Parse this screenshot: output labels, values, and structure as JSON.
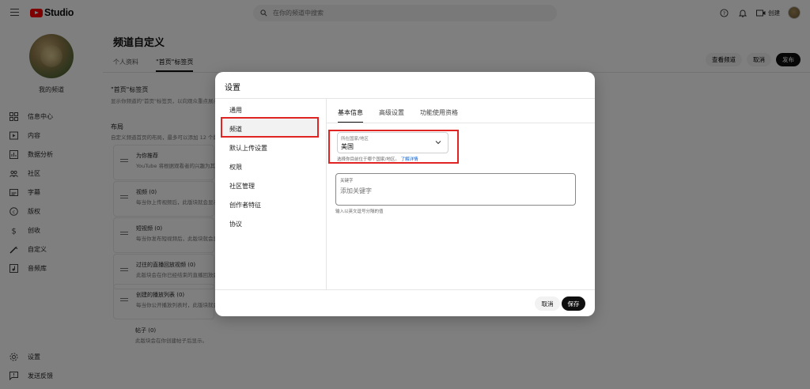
{
  "app": {
    "brand": "Studio",
    "brand_color": "#ff0000"
  },
  "search": {
    "placeholder": "在你的频道中搜索"
  },
  "topbar": {
    "create_label": "创建"
  },
  "sidebar": {
    "channel_name": "我的频道",
    "items": [
      {
        "label": "信息中心",
        "icon": "dashboard-icon"
      },
      {
        "label": "内容",
        "icon": "content-icon"
      },
      {
        "label": "数据分析",
        "icon": "analytics-icon"
      },
      {
        "label": "社区",
        "icon": "community-icon"
      },
      {
        "label": "字幕",
        "icon": "subtitles-icon"
      },
      {
        "label": "版权",
        "icon": "copyright-icon"
      },
      {
        "label": "创收",
        "icon": "dollar-icon"
      },
      {
        "label": "自定义",
        "icon": "customize-icon"
      },
      {
        "label": "音频库",
        "icon": "audio-library-icon"
      }
    ],
    "bottom": [
      {
        "label": "设置",
        "icon": "settings-icon"
      },
      {
        "label": "发送反馈",
        "icon": "feedback-icon"
      }
    ]
  },
  "page": {
    "title": "频道自定义",
    "tabs": [
      "个人资料",
      "\"首页\"标签页"
    ],
    "active_tab": 1,
    "buttons": {
      "view_channel": "查看频道",
      "cancel": "取消",
      "publish": "发布"
    },
    "section1": {
      "title": "\"首页\"标签页",
      "desc": "显示你频道的\"首页\"标签页，以向观众重点展示"
    },
    "layout": {
      "title": "布局",
      "desc": "自定义频道首页的布局，最多可以添加 12 个版块"
    },
    "rows": [
      {
        "title": "为你推荐",
        "desc": "YouTube 将根据观看者的兴趣为其推荐"
      },
      {
        "title": "视频 (0)",
        "desc": "每当你上传视频后，此版块就会显示"
      },
      {
        "title": "短视频 (0)",
        "desc": "每当你发布短视频后，此版块就会显示"
      },
      {
        "title": "过往的直播回放视频 (0)",
        "desc": "此版块会在你已经结束的直播回放后显示"
      },
      {
        "title": "创建的播放列表 (0)",
        "desc": "每当你公开播放列表时，此版块就会显示"
      }
    ],
    "post_row": {
      "title": "帖子 (0)",
      "desc": "此版块会在你创建帖子后显示。"
    }
  },
  "modal": {
    "title": "设置",
    "nav": [
      "通用",
      "频道",
      "默认上传设置",
      "权限",
      "社区管理",
      "创作者特征",
      "协议"
    ],
    "active_nav": 1,
    "tabs": [
      "基本信息",
      "高级设置",
      "功能使用资格"
    ],
    "active_tab": 0,
    "country": {
      "label": "所在国家/地区",
      "value": "美国",
      "help": "选择你目前位于哪个国家/地区。",
      "learn_more": "了解详情"
    },
    "keywords": {
      "label": "关键字",
      "placeholder": "添加关键字",
      "help": "输入以英文逗号分隔的值"
    },
    "cancel": "取消",
    "save": "保存"
  },
  "colors": {
    "highlight": "#e02424",
    "link": "#065fd4"
  }
}
